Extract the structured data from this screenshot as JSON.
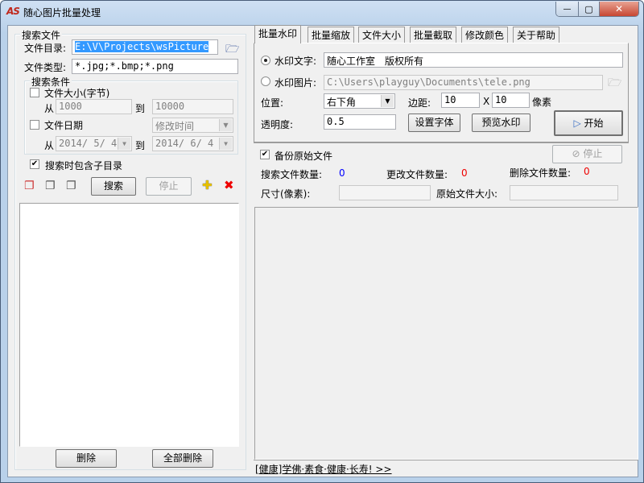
{
  "window": {
    "title": "随心图片批量处理",
    "logo": "AS",
    "min": "—",
    "max": "▢",
    "close": "✕"
  },
  "search": {
    "group": "搜索文件",
    "dir_label": "文件目录:",
    "dir_value": "E:\\V\\Projects\\wsPicture",
    "type_label": "文件类型:",
    "type_value": "*.jpg;*.bmp;*.png",
    "cond_group": "搜索条件",
    "size_label": "文件大小(字节)",
    "from": "从",
    "to": "到",
    "size_from": "1000",
    "size_to": "10000",
    "date_label": "文件日期",
    "date_type": "修改时间",
    "date_from": "2014/ 5/ 4",
    "date_to": "2014/ 6/ 4",
    "subdir_label": "搜索时包含子目录",
    "search_btn": "搜索",
    "stop_btn": "停止",
    "delete_btn": "删除",
    "delete_all_btn": "全部删除"
  },
  "tabs": [
    "批量水印",
    "批量缩放",
    "文件大小",
    "批量截取",
    "修改颜色",
    "关于帮助"
  ],
  "watermark": {
    "text_label": "水印文字:",
    "text_value": "随心工作室　版权所有",
    "image_label": "水印图片:",
    "image_value": "C:\\Users\\playguy\\Documents\\tele.png",
    "pos_label": "位置:",
    "pos_value": "右下角",
    "margin_label": "边距:",
    "margin_x": "10",
    "x": "X",
    "margin_y": "10",
    "px": "像素",
    "opacity_label": "透明度:",
    "opacity_value": "0.5",
    "font_btn": "设置字体",
    "preview_btn": "预览水印",
    "start_btn": "开始"
  },
  "status": {
    "backup_label": "备份原始文件",
    "stop_btn": "停止",
    "search_count_label": "搜索文件数量:",
    "search_count": "0",
    "changed_label": "更改文件数量:",
    "changed": "0",
    "deleted_label": "删除文件数量:",
    "deleted": "0",
    "size_label": "尺寸(像素):",
    "orig_size_label": "原始文件大小:"
  },
  "footer_link": "[健康]学佛·素食·健康·长寿! >>"
}
